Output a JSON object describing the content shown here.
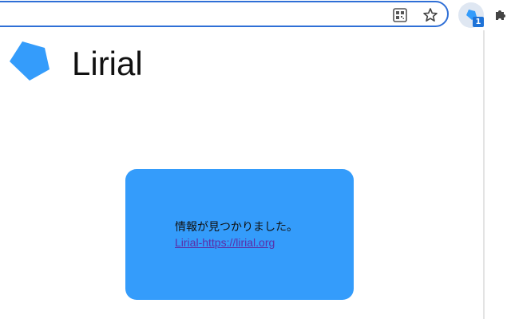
{
  "browser": {
    "icons": {
      "qr": "qr-code-icon",
      "star": "bookmark-star-icon",
      "extension": "lirial-extension-icon",
      "puzzle": "extensions-puzzle-icon"
    },
    "extension_badge": "1",
    "colors": {
      "omnibox_border": "#2f6fd6",
      "badge": "#1e73d8"
    }
  },
  "popup": {
    "logo_icon": "pentagon-logo-icon",
    "title": "Lirial",
    "card": {
      "message": "情報が見つかりました。",
      "link_text": "Lirial-https://lirial.org"
    },
    "colors": {
      "accent": "#349cfb",
      "link": "#5a2ea8"
    }
  }
}
